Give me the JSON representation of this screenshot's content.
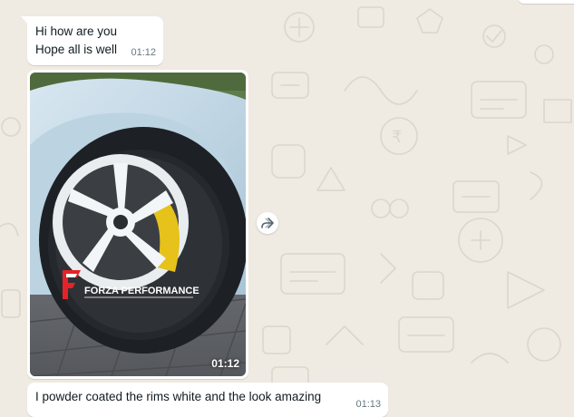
{
  "messages": {
    "greeting": {
      "lines": [
        "Hi how are you",
        "Hope all is well"
      ],
      "time": "01:12"
    },
    "image": {
      "time": "01:12",
      "watermark": "FORZA PERFORMANCE"
    },
    "caption": {
      "text": "I powder coated the rims white and the look amazing",
      "time": "01:13"
    }
  },
  "icons": {
    "forward": "forward-icon"
  },
  "colors": {
    "chat_background": "#efeae2",
    "bubble": "#ffffff",
    "timestamp": "#667781",
    "brand_red": "#e52228"
  }
}
